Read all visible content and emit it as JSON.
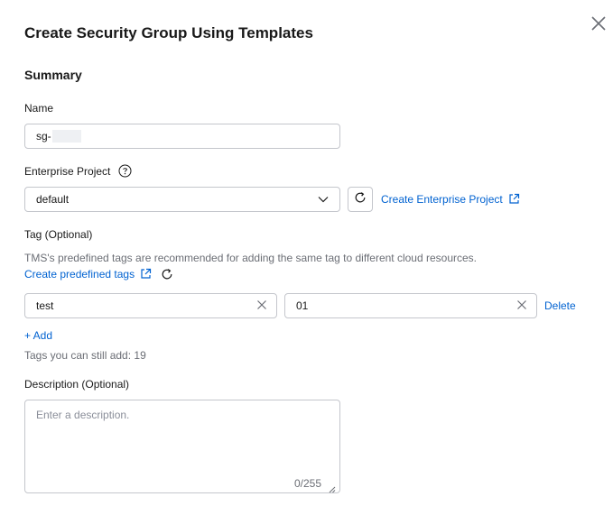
{
  "dialog": {
    "title": "Create Security Group Using Templates",
    "section_title": "Summary"
  },
  "name": {
    "label": "Name",
    "value": "sg-"
  },
  "enterprise_project": {
    "label": "Enterprise Project",
    "selected": "default",
    "create_link": "Create Enterprise Project"
  },
  "tag": {
    "label": "Tag (Optional)",
    "hint": "TMS's predefined tags are recommended for adding the same tag to different cloud resources.",
    "create_link": "Create predefined tags",
    "key_value": "test",
    "value_value": "01",
    "delete_label": "Delete",
    "add_label": "+ Add",
    "remaining": "Tags you can still add: 19"
  },
  "description": {
    "label": "Description (Optional)",
    "placeholder": "Enter a description.",
    "counter": "0/255"
  },
  "colors": {
    "link": "#0062d1",
    "border": "#c4c6cc",
    "text": "#191919",
    "muted": "#6b6e75"
  }
}
